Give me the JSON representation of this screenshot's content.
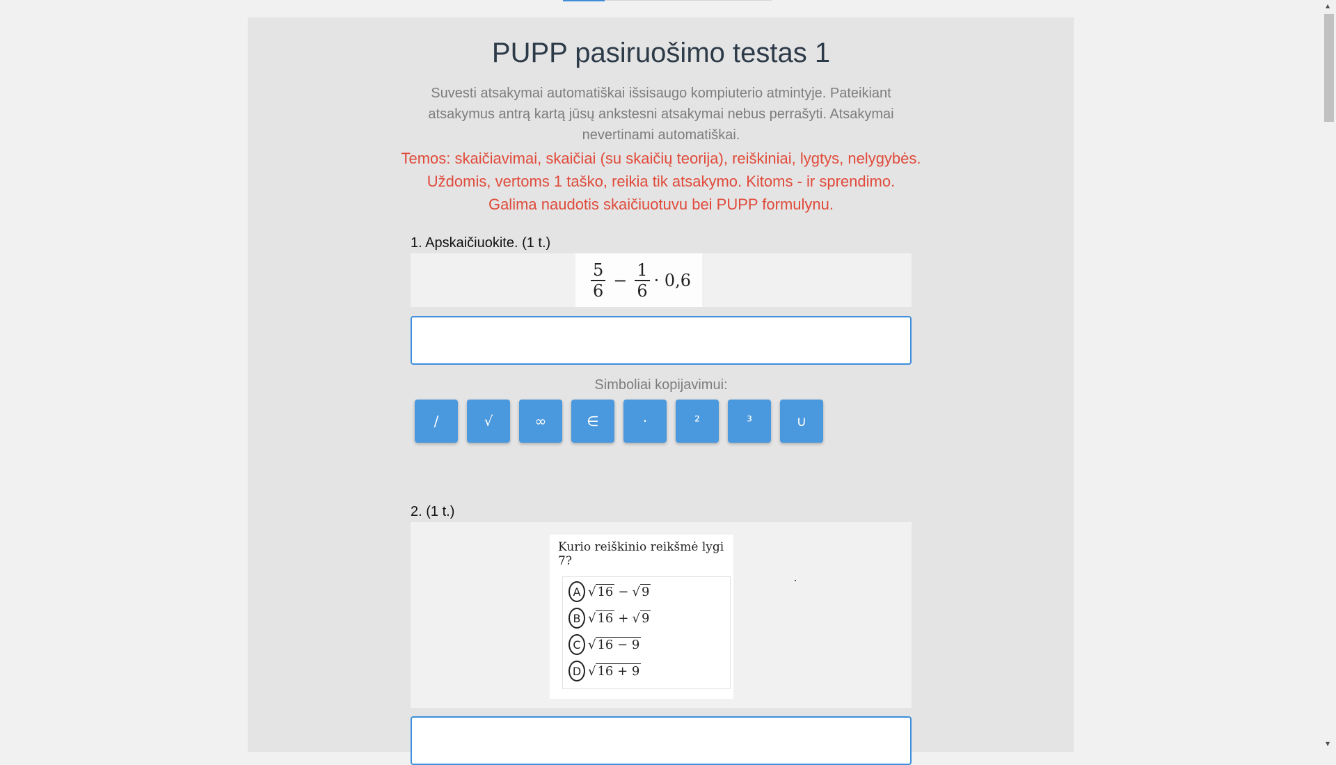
{
  "page": {
    "title": "PUPP pasiruošimo testas 1",
    "intro": "Suvesti atsakymai automatiškai išsisaugo kompiuterio atmintyje. Pateikiant atsakymus antrą kartą jūsų ankstesni atsakymai nebus perrašyti. Atsakymai nevertinami automatiškai.",
    "topics": "Temos: skaičiavimai, skaičiai (su skaičių teorija), reiškiniai, lygtys, nelygybės. Uždomis, vertoms 1 taško, reikia tik atsakymo. Kitoms - ir sprendimo. Galima naudotis skaičiuotuvu bei PUPP formulynu."
  },
  "q1": {
    "title": "1. Apskaičiuokite. (1 t.)",
    "formula": {
      "n1": "5",
      "d1": "6",
      "minus": "−",
      "n2": "1",
      "d2": "6",
      "rest": "· 0,6"
    },
    "answer_value": "",
    "answer_placeholder": ""
  },
  "symbols": {
    "label": "Simboliai kopijavimui:",
    "items": [
      "/",
      "√",
      "∞",
      "∈",
      "·",
      "²",
      "³",
      "∪"
    ]
  },
  "q2": {
    "title": "2. (1 t.)",
    "question": "Kurio reiškinio reikšmė lygi 7?",
    "options": [
      {
        "letter": "A",
        "a": "16",
        "op": "−",
        "b": "9"
      },
      {
        "letter": "B",
        "a": "16",
        "op": "+",
        "b": "9"
      },
      {
        "letter": "C",
        "expr": "16 − 9"
      },
      {
        "letter": "D",
        "expr": "16 + 9"
      }
    ],
    "answer_value": ""
  },
  "colors": {
    "accent": "#4a98dd",
    "topics": "#e04a3a",
    "title": "#2d3a48"
  },
  "scrollbar": {
    "up": "▲",
    "down": "▼"
  }
}
